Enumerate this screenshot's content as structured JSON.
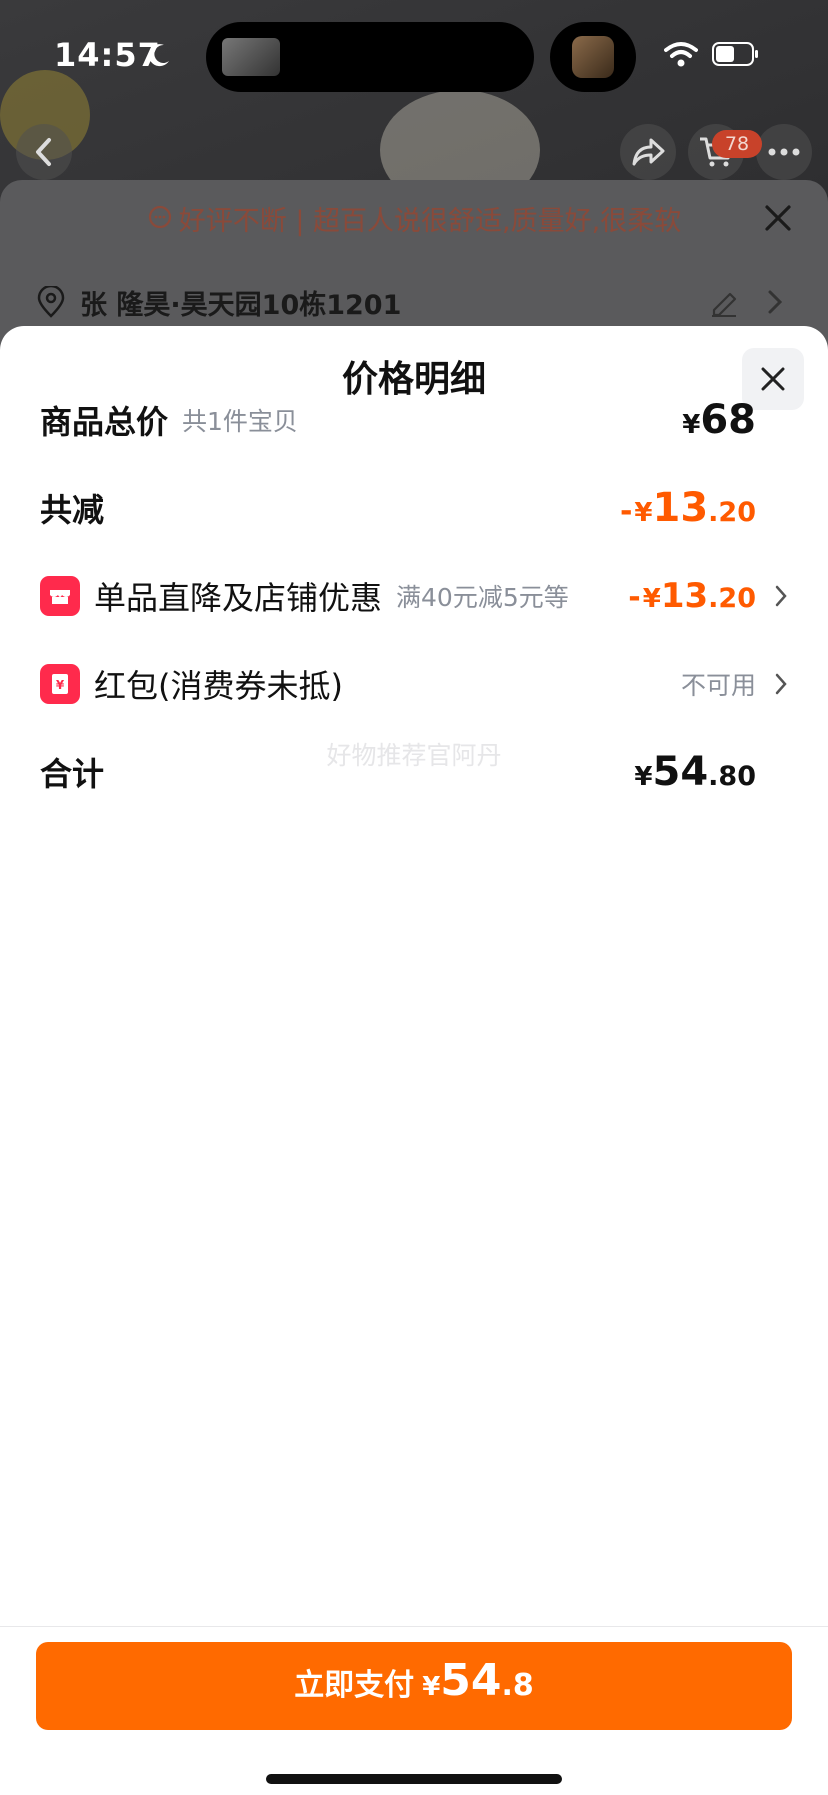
{
  "status_bar": {
    "time": "14:57"
  },
  "nav": {
    "cart_badge": "78"
  },
  "banner": {
    "text": "好评不断 | 超百人说很舒适,质量好,很柔软"
  },
  "address": {
    "text": "张 隆昊·昊天园10栋1201"
  },
  "sheet": {
    "title": "价格明细",
    "rows": [
      {
        "label": "商品总价",
        "sub": "共1件宝贝",
        "yen": "¥",
        "int": "68",
        "dec": ""
      },
      {
        "label": "共减",
        "minus": "-",
        "yen": "¥",
        "int": "13",
        "dec": ".20"
      },
      {
        "label": "单品直降及店铺优惠",
        "sub": "满40元减5元等",
        "minus": "-",
        "yen": "¥",
        "int": "13",
        "dec": ".20"
      },
      {
        "label": "红包(消费券未抵)",
        "value": "不可用"
      },
      {
        "label": "合计",
        "yen": "¥",
        "int": "54",
        "dec": ".80"
      }
    ],
    "watermark": "好物推荐官阿丹"
  },
  "pay_button": {
    "label": "立即支付",
    "yen": "¥",
    "int": "54",
    "dec": ".8"
  },
  "colors": {
    "accent": "#ff6a00",
    "discount": "#ff5a00",
    "tag_red": "#ff2a4c"
  }
}
